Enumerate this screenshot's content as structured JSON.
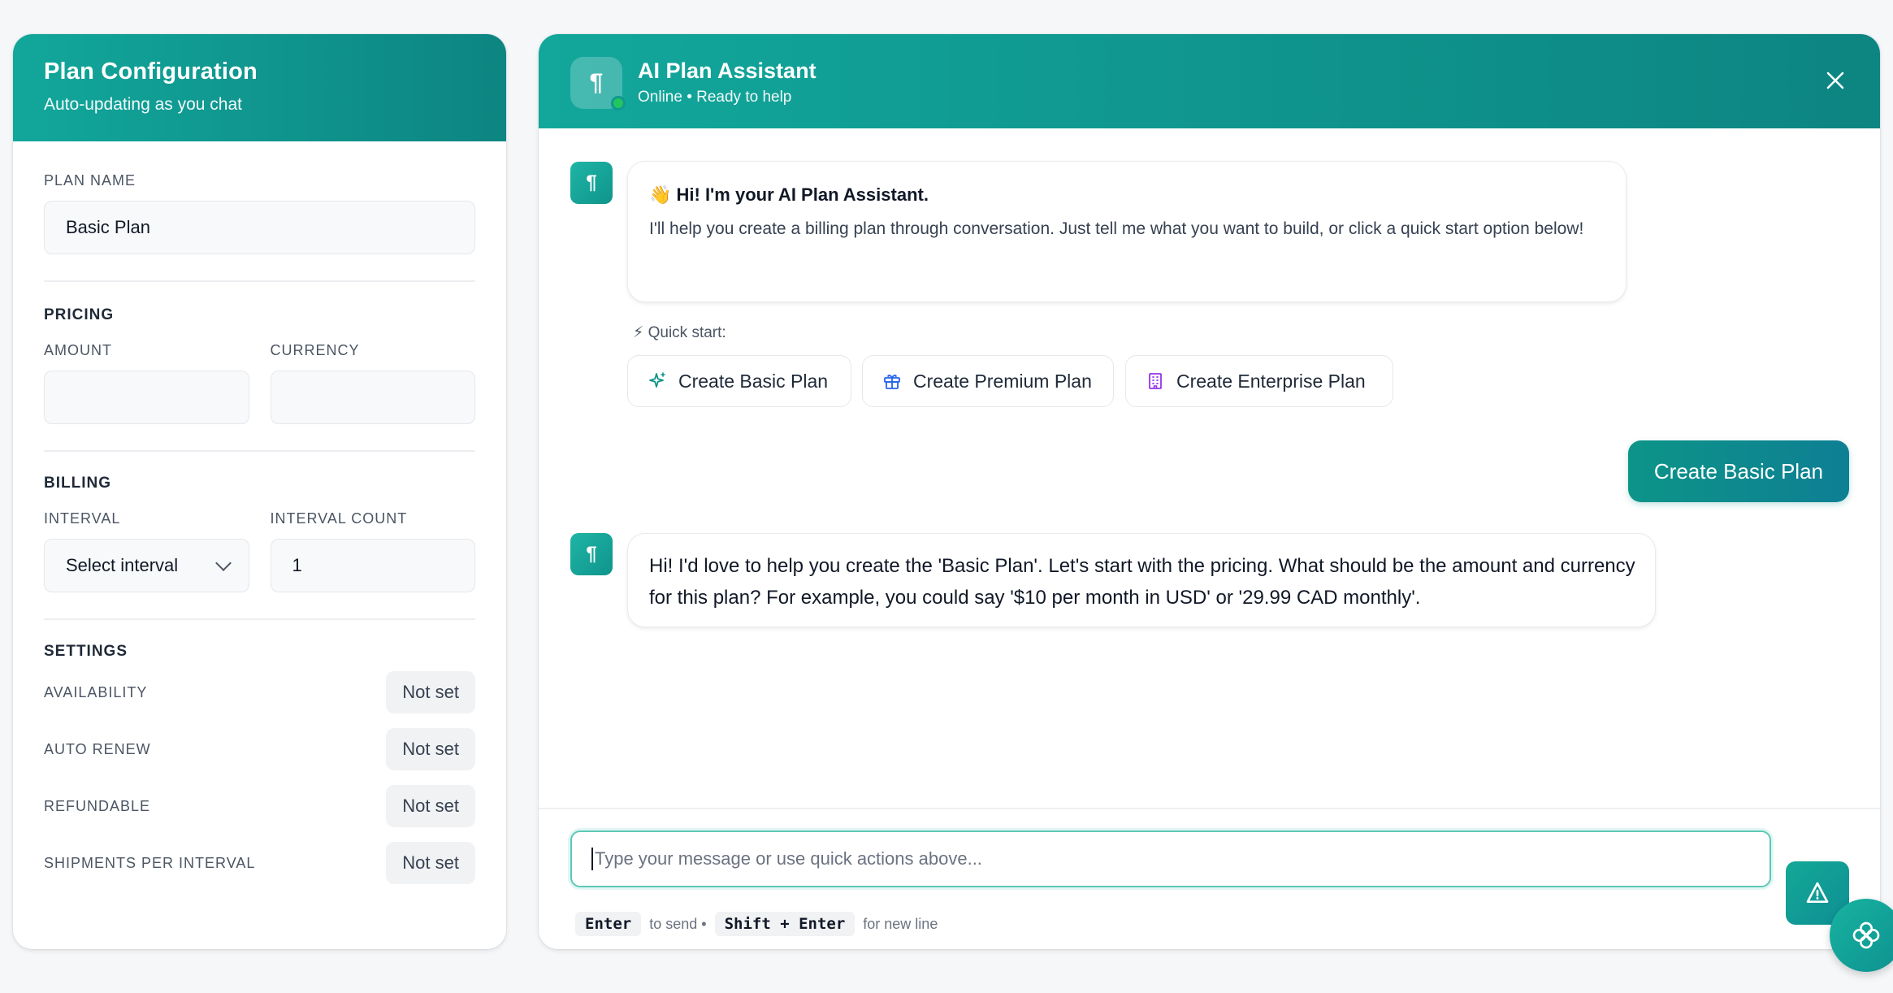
{
  "config": {
    "title": "Plan Configuration",
    "subtitle": "Auto-updating as you chat",
    "plan_name_label": "PLAN NAME",
    "plan_name_value": "Basic Plan",
    "pricing_label": "PRICING",
    "amount_label": "AMOUNT",
    "amount_value": "",
    "currency_label": "CURRENCY",
    "currency_value": "",
    "billing_label": "BILLING",
    "interval_label": "INTERVAL",
    "interval_value": "Select interval",
    "interval_count_label": "INTERVAL COUNT",
    "interval_count_value": "1",
    "settings_label": "SETTINGS",
    "settings": [
      {
        "label": "AVAILABILITY",
        "value": "Not set"
      },
      {
        "label": "AUTO RENEW",
        "value": "Not set"
      },
      {
        "label": "REFUNDABLE",
        "value": "Not set"
      },
      {
        "label": "SHIPMENTS PER INTERVAL",
        "value": "Not set"
      }
    ]
  },
  "chat": {
    "title": "AI Plan Assistant",
    "status": "Online • Ready to help",
    "avatar_glyph": "¶",
    "welcome_title": "👋 Hi! I'm your AI Plan Assistant.",
    "welcome_body": "I'll help you create a billing plan through conversation. Just tell me what you want to build, or click a quick start option below!",
    "quick_start_label": "⚡ Quick start:",
    "quick_actions": [
      {
        "label": "Create Basic Plan",
        "icon": "sparkle-icon"
      },
      {
        "label": "Create Premium Plan",
        "icon": "gift-icon"
      },
      {
        "label": "Create Enterprise Plan",
        "icon": "building-icon"
      }
    ],
    "user_message": "Create Basic Plan",
    "bot_reply": "Hi! I'd love to help you create the 'Basic Plan'. Let's start with the pricing. What should be the amount and currency for this plan? For example, you could say '$10 per month in USD' or '29.99 CAD monthly'.",
    "input_placeholder": "Type your message or use quick actions above...",
    "hint_enter": "Enter",
    "hint_send": "to send •",
    "hint_shift_enter": "Shift + Enter",
    "hint_newline": "for new line"
  },
  "colors": {
    "accent": "#12a79b",
    "accent_dark": "#0d8582",
    "online": "#22c55e"
  }
}
